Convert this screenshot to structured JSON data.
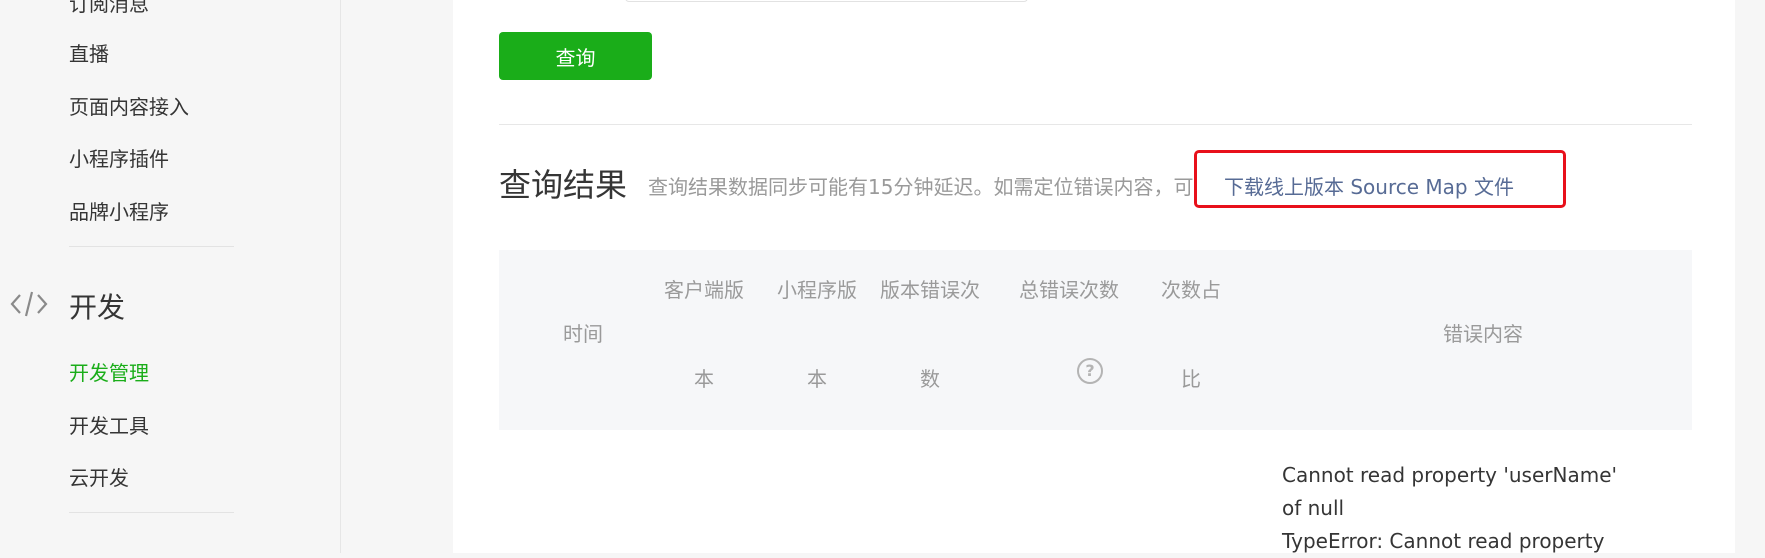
{
  "sidebar": {
    "items_top": [
      {
        "label": "订阅消息"
      },
      {
        "label": "直播"
      },
      {
        "label": "页面内容接入"
      },
      {
        "label": "小程序插件"
      },
      {
        "label": "品牌小程序"
      }
    ],
    "section_title": "开发",
    "items_dev": [
      {
        "label": "开发管理",
        "active": true
      },
      {
        "label": "开发工具"
      },
      {
        "label": "云开发"
      }
    ]
  },
  "main": {
    "query_button": "查询",
    "result_title": "查询结果",
    "result_hint": "查询结果数据同步可能有15分钟延迟。如需定位错误内容，可",
    "result_link": "下载线上版本 Source Map 文件",
    "table": {
      "columns": [
        {
          "line1": "时间",
          "line2": ""
        },
        {
          "line1": "客户端版",
          "line2": "本"
        },
        {
          "line1": "小程序版",
          "line2": "本"
        },
        {
          "line1": "版本错误次",
          "line2": "数"
        },
        {
          "line1": "总错误次数",
          "line2": "?"
        },
        {
          "line1": "次数占",
          "line2": "比"
        },
        {
          "line1": "错误内容",
          "line2": ""
        }
      ],
      "first_row_error_lines": [
        "Cannot read property 'userName'",
        "of null",
        "TypeError: Cannot read property"
      ]
    }
  },
  "colors": {
    "accent_green": "#1aad19",
    "link_blue": "#576b95",
    "highlight_red": "#e8101b"
  }
}
